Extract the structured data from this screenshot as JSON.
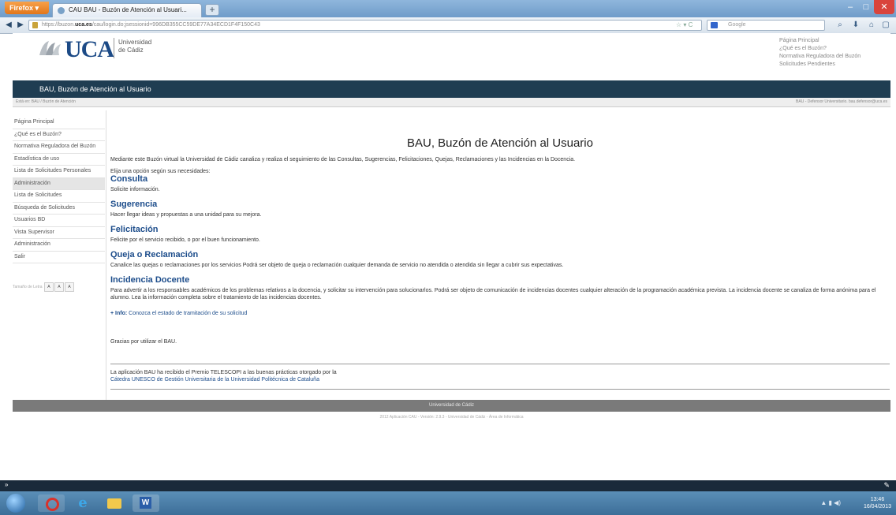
{
  "browser": {
    "menu_button": "Firefox ▾",
    "tab_title": "CAU BAU - Buzón de Atención al Usuari...",
    "new_tab": "+",
    "back": "◀",
    "forward": "▶",
    "url_prefix": "https://buzon.",
    "url_domain": "uca.es",
    "url_suffix": "/cau/login.do;jsessionid=996DB355CC59DE77A34ECD1F4F150C43",
    "url_controls": "☆ ▾ C",
    "search_placeholder": "Google",
    "minimize": "–",
    "maximize": "□",
    "close": "✕"
  },
  "header": {
    "logo_text": "UCA",
    "logo_sub_line1": "Universidad",
    "logo_sub_line2": "de Cádiz",
    "top_links": [
      "Página Principal",
      "¿Qué es el Buzón?",
      "Normativa Reguladora del Buzón",
      "Solicitudes Pendientes"
    ]
  },
  "banner": {
    "title": "BAU, Buzón de Atención al Usuario"
  },
  "breadcrumb": {
    "left": "Está en: BAU / Buzón de Atención",
    "right": "BAU - Defensor Universitario. bau.defensor@uca.es"
  },
  "sidebar": {
    "items": [
      "Página Principal",
      "¿Qué es el Buzón?",
      "Normativa Reguladora del Buzón",
      "Estadística de uso",
      "Lista de Solicitudes Personales",
      "Administración",
      "Lista de Solicitudes",
      "Búsqueda de Solicitudes",
      "Usuarios BD",
      "Vista Supervisor",
      "Administración",
      "Salir"
    ],
    "font_size_label": "Tamaño de Letra",
    "font_buttons": [
      "A",
      "A",
      "A"
    ]
  },
  "main": {
    "title": "BAU, Buzón de Atención al Usuario",
    "intro": "Mediante este Buzón virtual la Universidad de Cádiz canaliza y realiza el seguimiento de las Consultas, Sugerencias, Felicitaciones, Quejas, Reclamaciones y las Incidencias en la Docencia.",
    "intro2": "Elija una opción según sus necesidades:",
    "sections": [
      {
        "title": "Consulta",
        "desc": "Solicite información."
      },
      {
        "title": "Sugerencia",
        "desc": "Hacer llegar ideas y propuestas a una unidad para su mejora."
      },
      {
        "title": "Felicitación",
        "desc": "Felicite por el servicio recibido, o por el buen funcionamiento."
      },
      {
        "title": "Queja o Reclamación",
        "desc": "Canalice las quejas o reclamaciones por los servicios Podrá ser objeto de queja o reclamación cualquier demanda de servicio no atendida o atendida sin llegar a cubrir sus expectativas."
      },
      {
        "title": "Incidencia Docente",
        "desc": "Para advertir a los responsables académicos de los problemas relativos a la docencia, y solicitar su intervención para solucionarlos. Podrá ser objeto de comunicación de incidencias docentes cualquier alteración de la programación académica prevista. La incidencia docente se canaliza de forma anónima para el alumno. Lea la información completa sobre el tratamiento de las incidencias docentes."
      }
    ],
    "info_label": "+ Info:",
    "info_link": "Conozca el estado de tramitación de su solicitud",
    "thanks": "Gracias por utilizar el BAU.",
    "award_line1": "La aplicación BAU ha recibido el Premio TELESCOPI a las buenas prácticas otorgado por la",
    "award_line2": "Cátedra UNESCO de Gestión Universitaria de la Universidad Politécnica de Cataluña"
  },
  "footer": {
    "bar": "Universidad de Cádiz",
    "sub": "2012 Aplicación CAU - Versión: 2.9.3 - Universidad de Cádiz - Área de Informática"
  },
  "taskbar": {
    "tray": "▲ ▮ ◀)",
    "time": "13:46",
    "date": "16/04/2013"
  }
}
